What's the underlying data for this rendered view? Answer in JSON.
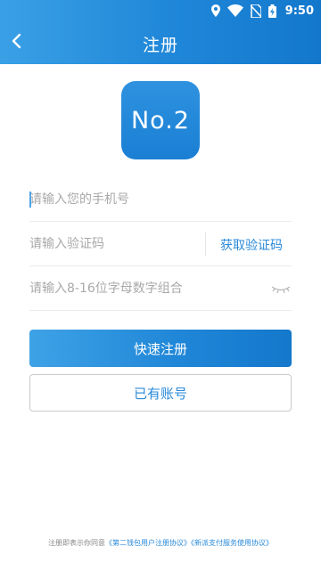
{
  "status_bar": {
    "time": "9:50",
    "icons": [
      "location-icon",
      "wifi-icon",
      "no-sim-icon",
      "battery-charging-icon"
    ]
  },
  "header": {
    "title": "注册",
    "back_icon": "chevron-left-icon"
  },
  "logo": {
    "text": "No.2"
  },
  "form": {
    "phone_placeholder": "请输入您的手机号",
    "code_placeholder": "请输入验证码",
    "get_code_label": "获取验证码",
    "password_placeholder": "请输入8-16位字母数字组合",
    "password_toggle_icon": "eye-closed-icon"
  },
  "buttons": {
    "register_label": "快速注册",
    "have_account_label": "已有账号"
  },
  "footer": {
    "prefix": "注册即表示你同意",
    "agreement1": "《第二钱包用户注册协议》",
    "agreement2": "《新派支付服务使用协议》"
  },
  "colors": {
    "brand_blue": "#1f86d8",
    "link_blue": "#2a8ad9"
  }
}
